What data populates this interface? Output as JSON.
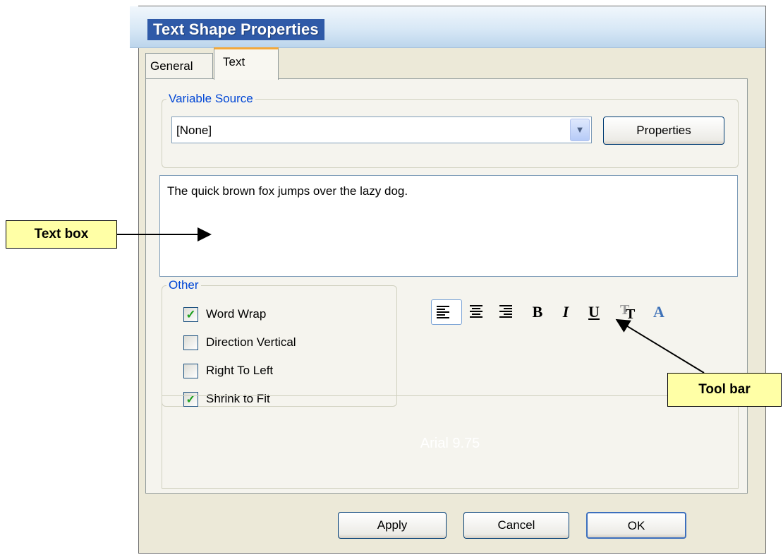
{
  "window": {
    "title": "Text Shape Properties"
  },
  "tabs": [
    {
      "label": "General",
      "selected": false
    },
    {
      "label": "Text",
      "selected": true
    }
  ],
  "variable_source": {
    "legend": "Variable Source",
    "selected_value": "[None]",
    "properties_button": "Properties"
  },
  "text_box": {
    "content": "The quick brown fox jumps over the lazy dog."
  },
  "other": {
    "legend": "Other",
    "options": [
      {
        "label": "Word Wrap",
        "checked": true
      },
      {
        "label": "Direction Vertical",
        "checked": false
      },
      {
        "label": "Right To Left",
        "checked": false
      },
      {
        "label": "Shrink to Fit",
        "checked": true
      }
    ]
  },
  "toolbar": {
    "items": [
      {
        "name": "align-left",
        "icon": "align-left-icon",
        "selected": true
      },
      {
        "name": "align-center",
        "icon": "align-center-icon",
        "selected": false
      },
      {
        "name": "align-right",
        "icon": "align-right-icon",
        "selected": false
      },
      {
        "name": "bold",
        "glyph": "B"
      },
      {
        "name": "italic",
        "glyph": "I"
      },
      {
        "name": "underline",
        "glyph": "U"
      },
      {
        "name": "font",
        "icon": "font-icon"
      },
      {
        "name": "font-color",
        "glyph": "A",
        "color": "#3f72b8"
      }
    ]
  },
  "font_info": "Arial  9.75",
  "buttons": {
    "apply": "Apply",
    "cancel": "Cancel",
    "ok": "OK"
  },
  "annotations": {
    "text_box_label": "Text box",
    "tool_bar_label": "Tool bar"
  },
  "colors": {
    "dialog_bg": "#ece9d8",
    "title_bar": "#2f5aa8",
    "legend_text": "#0046d5",
    "callout_bg": "#ffffa6",
    "tab_highlight": "#f3a83a"
  }
}
